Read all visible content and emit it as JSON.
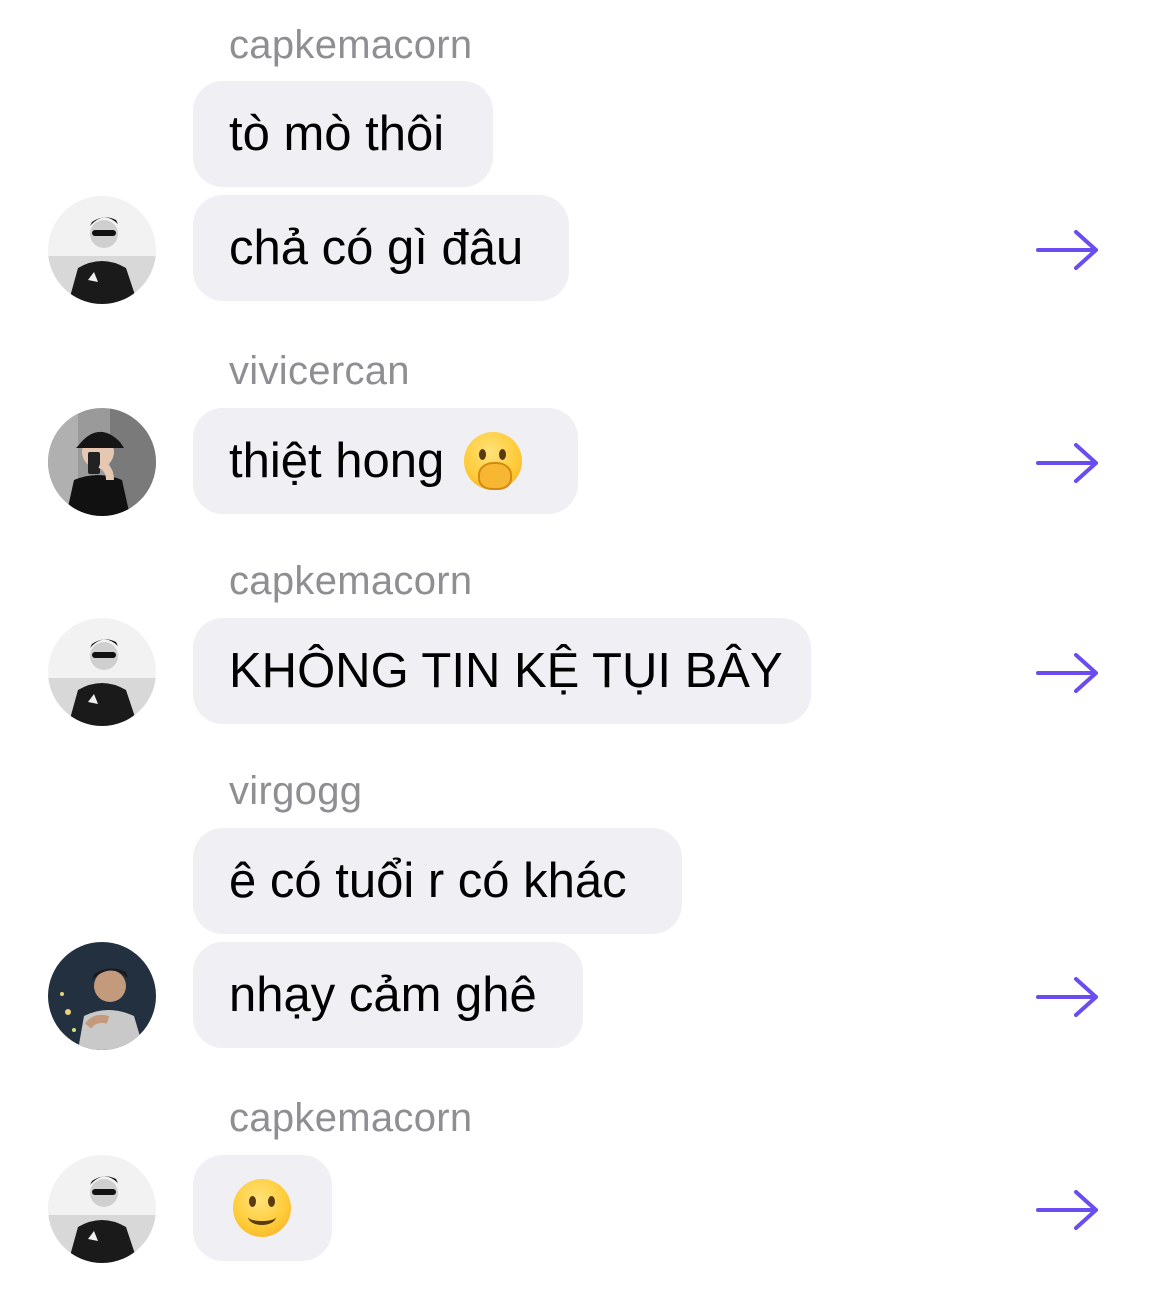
{
  "colors": {
    "accent": "#6a4cf0",
    "bubble": "#efeff4",
    "sender": "#8e8e93"
  },
  "groups": [
    {
      "sender": "capkemacorn",
      "messages": [
        "tò mò thôi",
        "chả có gì đâu"
      ]
    },
    {
      "sender": "vivicercan",
      "messages": [
        "thiệt hong"
      ],
      "emoji": "face-with-hand-over-mouth-emoji"
    },
    {
      "sender": "capkemacorn",
      "messages": [
        "KHÔNG TIN KỆ TỤI BÂY"
      ]
    },
    {
      "sender": "virgogg",
      "messages": [
        "ê có tuổi r có khác",
        "nhạy cảm ghê"
      ]
    },
    {
      "sender": "capkemacorn",
      "messages": [],
      "emoji": "slightly-smiling-face-emoji"
    }
  ]
}
